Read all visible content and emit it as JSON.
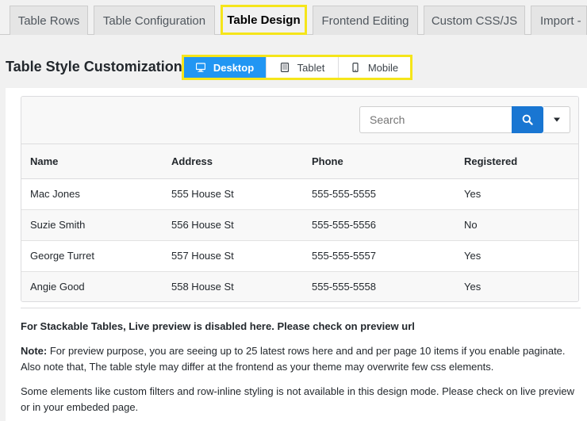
{
  "tabs": [
    {
      "label": "Table Rows"
    },
    {
      "label": "Table Configuration"
    },
    {
      "label": "Table Design"
    },
    {
      "label": "Frontend Editing"
    },
    {
      "label": "Custom CSS/JS"
    },
    {
      "label": "Import -"
    }
  ],
  "active_tab": "Table Design",
  "heading": "Table Style Customization",
  "devices": [
    {
      "label": "Desktop",
      "icon": "desktop-icon"
    },
    {
      "label": "Tablet",
      "icon": "tablet-icon"
    },
    {
      "label": "Mobile",
      "icon": "mobile-icon"
    }
  ],
  "active_device": "Desktop",
  "search": {
    "placeholder": "Search"
  },
  "table": {
    "headers": [
      "Name",
      "Address",
      "Phone",
      "Registered"
    ],
    "rows": [
      [
        "Mac Jones",
        "555 House St",
        "555-555-5555",
        "Yes"
      ],
      [
        "Suzie Smith",
        "556 House St",
        "555-555-5556",
        "No"
      ],
      [
        "George Turret",
        "557 House St",
        "555-555-5557",
        "Yes"
      ],
      [
        "Angie Good",
        "558 House St",
        "555-555-5558",
        "Yes"
      ]
    ]
  },
  "notes": {
    "stackable": "For Stackable Tables, Live preview is disabled here. Please check on preview url",
    "note_label": "Note:",
    "note_text": " For preview purpose, you are seeing up to 25 latest rows here and and per page 10 items if you enable paginate. Also note that, The table style may differ at the frontend as your theme may overwrite few css elements.",
    "elements": "Some elements like custom filters and row-inline styling is not available in this design mode. Please check on live preview or in your embeded page."
  },
  "colors": {
    "accent": "#2196f3",
    "search_button": "#1976d2",
    "highlight": "#f5e51a"
  }
}
